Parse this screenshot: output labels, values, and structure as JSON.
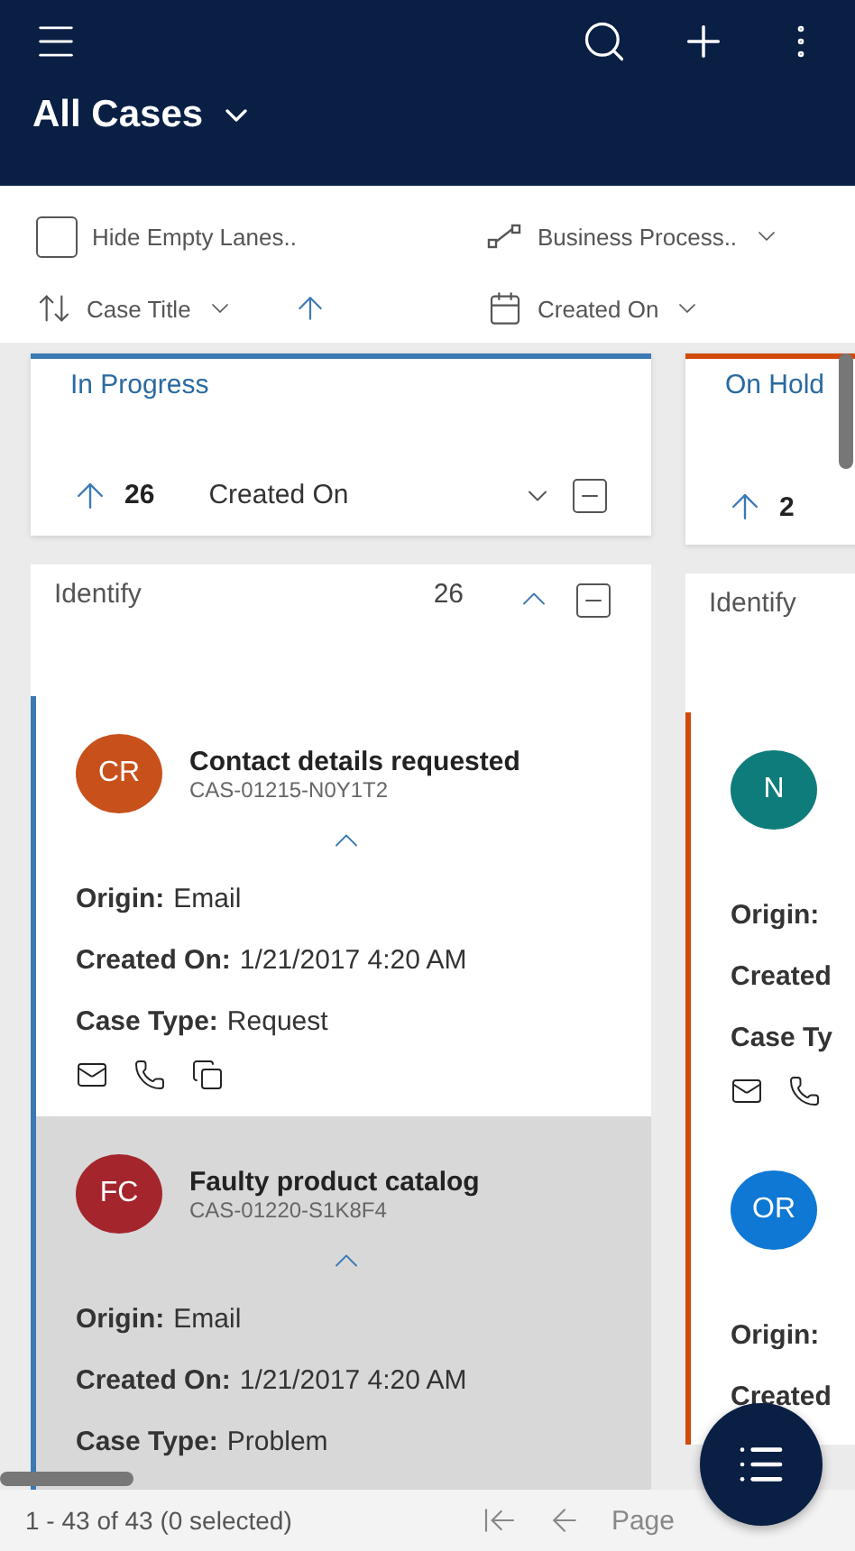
{
  "header": {
    "title": "All Cases"
  },
  "toolbar": {
    "hide_empty": {
      "label": "Hide Empty Lanes..",
      "checked": false
    },
    "process": "Business Process..",
    "sort_field": "Case Title",
    "date_field": "Created On"
  },
  "lanes": [
    {
      "title": "In Progress",
      "color": "#3b79b4",
      "count": "26",
      "sort": "Created On",
      "stage": {
        "name": "Identify",
        "count": "26"
      },
      "cards": [
        {
          "initials": "CR",
          "color": "#c8511b",
          "title": "Contact details requested",
          "number": "CAS-01215-N0Y1T2",
          "selected": false,
          "fields": [
            {
              "label": "Origin:",
              "value": "Email"
            },
            {
              "label": "Created On:",
              "value": "1/21/2017 4:20 AM"
            },
            {
              "label": "Case Type:",
              "value": "Request"
            }
          ],
          "actions": [
            {
              "kind": "mail"
            },
            {
              "kind": "phone"
            },
            {
              "kind": "document"
            }
          ]
        },
        {
          "initials": "FC",
          "color": "#a4262c",
          "title": "Faulty product catalog",
          "number": "CAS-01220-S1K8F4",
          "selected": true,
          "fields": [
            {
              "label": "Origin:",
              "value": "Email"
            },
            {
              "label": "Created On:",
              "value": "1/21/2017 4:20 AM"
            },
            {
              "label": "Case Type:",
              "value": "Problem"
            }
          ]
        }
      ]
    },
    {
      "title": "On Hold",
      "color": "#d04a0a",
      "count": "2",
      "stage": {
        "name": "Identify"
      },
      "cards": [
        {
          "initials": "N",
          "color": "#0e7c7b",
          "selected": false,
          "fields": [
            {
              "label": "Origin:"
            },
            {
              "label": "Created"
            },
            {
              "label": "Case Ty"
            }
          ],
          "actions": [
            {
              "kind": "mail"
            },
            {
              "kind": "phone"
            }
          ]
        },
        {
          "initials": "OR",
          "color": "#0f78d4",
          "selected": false,
          "fields": [
            {
              "label": "Origin:"
            },
            {
              "label": "Created"
            }
          ]
        }
      ]
    }
  ],
  "footer": {
    "summary": "1 - 43 of 43 (0 selected)",
    "page_label": "Page"
  }
}
